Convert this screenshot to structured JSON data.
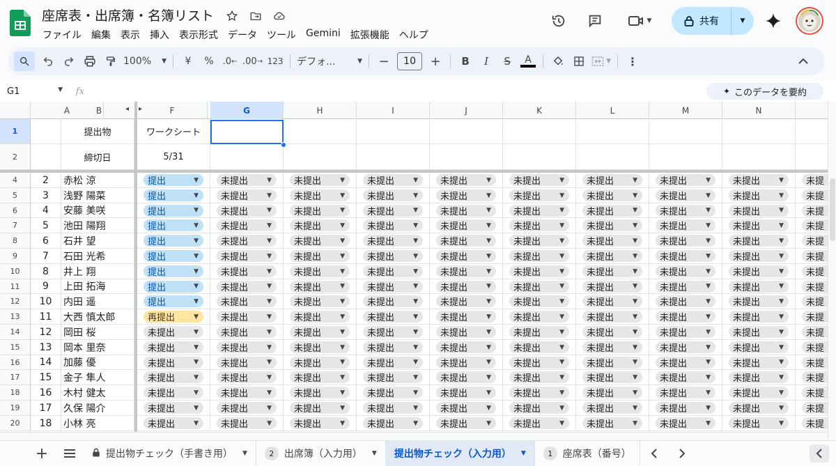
{
  "doc": {
    "title": "座席表・出席簿・名簿リスト"
  },
  "menu": [
    "ファイル",
    "編集",
    "表示",
    "挿入",
    "表示形式",
    "データ",
    "ツール",
    "Gemini",
    "拡張機能",
    "ヘルプ"
  ],
  "share": {
    "label": "共有"
  },
  "toolbar": {
    "zoom": "100%",
    "currency": "¥",
    "percent": "%",
    "dec_decrease": ".0",
    "dec_increase": ".00",
    "number_format": "123",
    "font": "デフォ...",
    "font_size": "10",
    "bold": "B",
    "italic": "I",
    "strike": "S",
    "text_color": "A"
  },
  "formula_bar": {
    "name_box": "G1",
    "fx": "fx",
    "summarize_label": "このデータを要約"
  },
  "columns": [
    "A",
    "B",
    "F",
    "G",
    "H",
    "I",
    "J",
    "K",
    "L",
    "M",
    "N"
  ],
  "selected_column": "G",
  "header_rows": [
    {
      "num": "1",
      "label": "提出物",
      "value": "ワークシート"
    },
    {
      "num": "2",
      "label": "締切日",
      "value": "5/31"
    }
  ],
  "rows": [
    {
      "row": "4",
      "no": "2",
      "name": "赤松 涼",
      "f": "提出"
    },
    {
      "row": "5",
      "no": "3",
      "name": "浅野 陽菜",
      "f": "提出"
    },
    {
      "row": "6",
      "no": "4",
      "name": "安藤 美咲",
      "f": "提出"
    },
    {
      "row": "7",
      "no": "5",
      "name": "池田 陽翔",
      "f": "提出"
    },
    {
      "row": "8",
      "no": "6",
      "name": "石井 望",
      "f": "提出"
    },
    {
      "row": "9",
      "no": "7",
      "name": "石田 光希",
      "f": "提出"
    },
    {
      "row": "10",
      "no": "8",
      "name": "井上 翔",
      "f": "提出"
    },
    {
      "row": "11",
      "no": "9",
      "name": "上田 拓海",
      "f": "提出"
    },
    {
      "row": "12",
      "no": "10",
      "name": "内田 遥",
      "f": "提出"
    },
    {
      "row": "13",
      "no": "11",
      "name": "大西 慎太郎",
      "f": "再提出"
    },
    {
      "row": "14",
      "no": "12",
      "name": "岡田 桜",
      "f": "未提出"
    },
    {
      "row": "15",
      "no": "13",
      "name": "岡本 里奈",
      "f": "未提出"
    },
    {
      "row": "16",
      "no": "14",
      "name": "加藤 優",
      "f": "未提出"
    },
    {
      "row": "17",
      "no": "15",
      "name": "金子 隼人",
      "f": "未提出"
    },
    {
      "row": "18",
      "no": "16",
      "name": "木村 健太",
      "f": "未提出"
    },
    {
      "row": "19",
      "no": "17",
      "name": "久保 陽介",
      "f": "未提出"
    },
    {
      "row": "20",
      "no": "18",
      "name": "小林 亮",
      "f": "未提出"
    }
  ],
  "default_status": "未提出",
  "truncated_status": "未提",
  "status_colors": {
    "提出": "#bfe1f6",
    "再提出": "#ffe5a0",
    "未提出": "#e6e6e6"
  },
  "sheet_tabs": [
    {
      "label": "提出物チェック（手書き用）",
      "badge": "",
      "locked": true,
      "active": false
    },
    {
      "label": "出席簿（入力用）",
      "badge": "2",
      "locked": false,
      "active": false
    },
    {
      "label": "提出物チェック（入力用）",
      "badge": "",
      "locked": false,
      "active": true
    },
    {
      "label": "座席表（番号）",
      "badge": "1",
      "locked": false,
      "active": false
    }
  ]
}
